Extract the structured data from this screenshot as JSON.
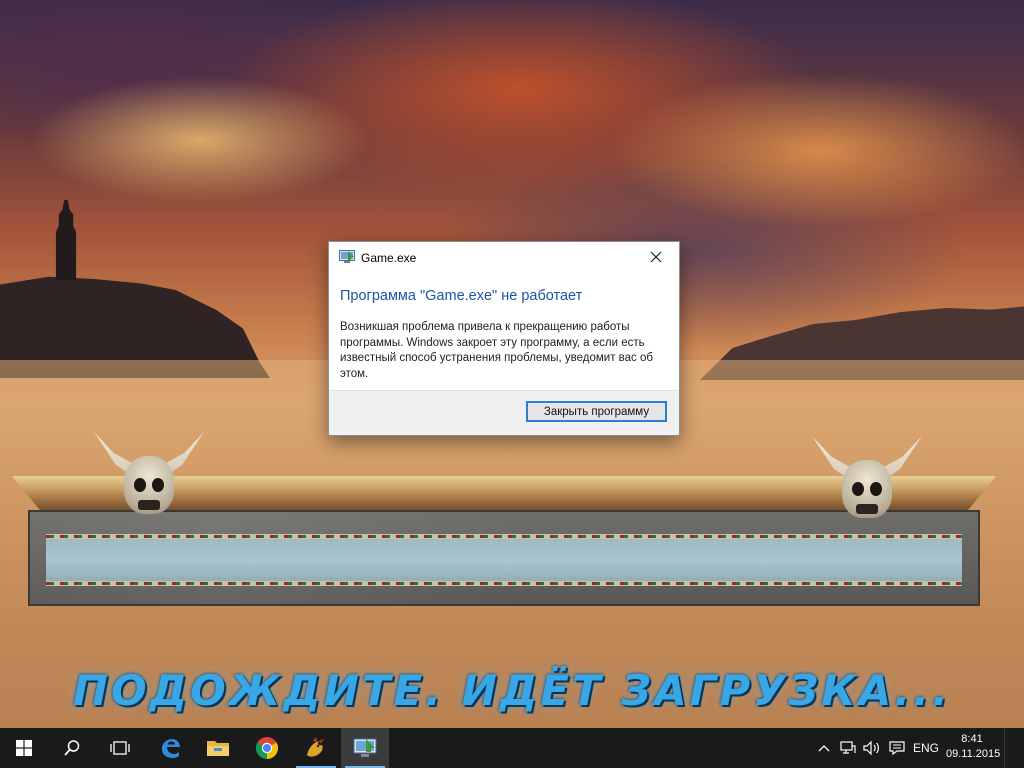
{
  "background": {
    "loading_text": "ПОДОЖДИТЕ. ИДЁТ ЗАГРУЗКА..."
  },
  "dialog": {
    "title": "Game.exe",
    "heading": "Программа \"Game.exe\" не работает",
    "body": "Возникшая проблема привела к прекращению работы программы. Windows закроет эту программу, а если есть известный способ устранения проблемы, уведомит вас об этом.",
    "button_label": "Закрыть программу",
    "close_icon": "close-icon"
  },
  "taskbar": {
    "apps": [
      {
        "icon": "windows-start-icon"
      },
      {
        "icon": "search-icon"
      },
      {
        "icon": "task-view-icon"
      },
      {
        "icon": "edge-icon"
      },
      {
        "icon": "file-explorer-icon"
      },
      {
        "icon": "chrome-icon"
      },
      {
        "icon": "game-dragon-icon"
      },
      {
        "icon": "error-report-icon"
      }
    ],
    "tray": {
      "language": "ENG",
      "time": "8:41",
      "date": "09.11.2015"
    }
  },
  "colors": {
    "taskbar_bg": "#1a1a1a",
    "dialog_heading": "#1a55a8",
    "button_focus_border": "#2d7ed4",
    "loading_text": "#38a7e8"
  }
}
